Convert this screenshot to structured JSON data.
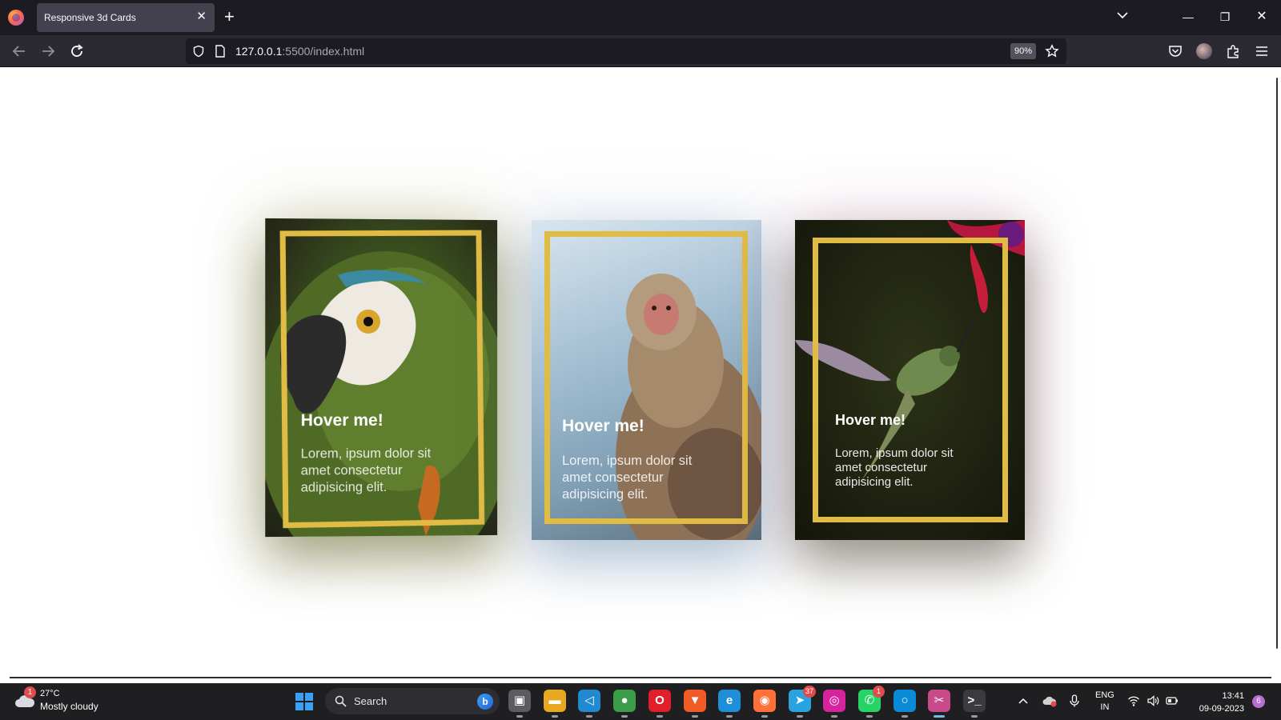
{
  "browser": {
    "tab_title": "Responsive 3d Cards",
    "tab_close": "✕",
    "new_tab": "+",
    "url_host": "127.0.0.1",
    "url_rest": ":5500/index.html",
    "zoom": "90%",
    "win_minimize": "—",
    "win_restore": "❐",
    "win_close": "✕"
  },
  "cards": [
    {
      "title": "Hover me!",
      "text": "Lorem, ipsum dolor sit amet consectetur adipisicing elit.",
      "subject": "parrot"
    },
    {
      "title": "Hover me!",
      "text": "Lorem, ipsum dolor sit amet consectetur adipisicing elit.",
      "subject": "monkey"
    },
    {
      "title": "Hover me!",
      "text": "Lorem, ipsum dolor sit amet consectetur adipisicing elit.",
      "subject": "hummingbird"
    }
  ],
  "colors": {
    "card_frame": "#e1bc45",
    "chrome_bg": "#1c1b22",
    "toolbar_bg": "#2b2a33",
    "taskbar_bg": "#1f1f22"
  },
  "taskbar": {
    "weather_badge": "1",
    "weather_temp": "27°C",
    "weather_condition": "Mostly cloudy",
    "search_label": "Search",
    "bing": "b",
    "apps": [
      {
        "name": "task-view",
        "glyph": "▣",
        "color": "#5b5b62"
      },
      {
        "name": "file-explorer",
        "glyph": "▬",
        "color": "#e8a820"
      },
      {
        "name": "vscode",
        "glyph": "◁",
        "color": "#1f8ad2"
      },
      {
        "name": "chrome",
        "glyph": "●",
        "color": "#3b9c49"
      },
      {
        "name": "opera",
        "glyph": "O",
        "color": "#e0212b"
      },
      {
        "name": "brave",
        "glyph": "▼",
        "color": "#f05a24"
      },
      {
        "name": "edge",
        "glyph": "e",
        "color": "#1d8fd8"
      },
      {
        "name": "firefox",
        "glyph": "◉",
        "color": "#ff7139"
      },
      {
        "name": "telegram",
        "glyph": "➤",
        "color": "#2aa3de",
        "badge": "37"
      },
      {
        "name": "instagram",
        "glyph": "◎",
        "color": "#d6249f"
      },
      {
        "name": "whatsapp",
        "glyph": "✆",
        "color": "#25d366",
        "badge": "1"
      },
      {
        "name": "cortana",
        "glyph": "○",
        "color": "#0b8ad6"
      },
      {
        "name": "snipping-tool",
        "glyph": "✂",
        "color": "#c94a8a",
        "active": true
      },
      {
        "name": "terminal",
        "glyph": ">_",
        "color": "#3b3b3f"
      }
    ],
    "language_top": "ENG",
    "language_bottom": "IN",
    "time": "13:41",
    "date": "09-09-2023",
    "notification_count": "6"
  }
}
